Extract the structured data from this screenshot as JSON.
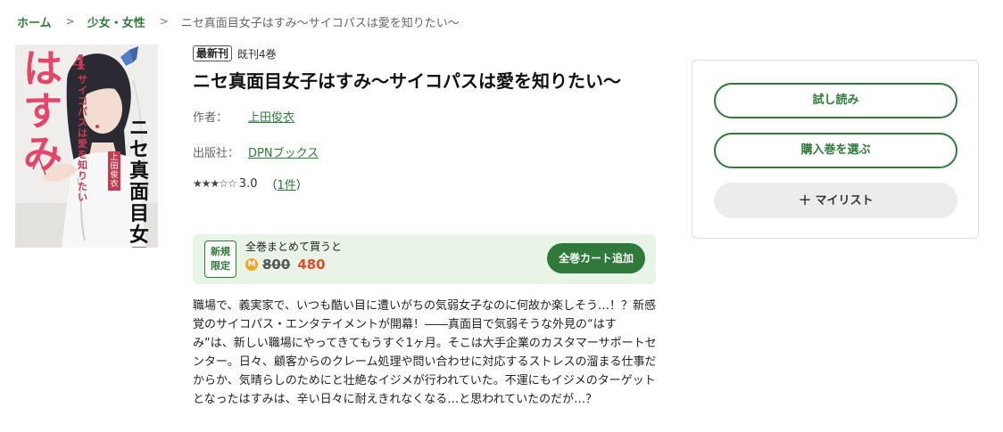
{
  "breadcrumb": {
    "items": [
      "ホーム",
      "少女・女性"
    ],
    "current": "ニセ真面目女子はすみ〜サイコパスは愛を知りたい〜"
  },
  "cover": {
    "volume_number": "4",
    "title_vertical": "はすみ",
    "subtitle_vertical": "サイコパスは愛を知りたい",
    "main_vertical": "ニセ真面目女子",
    "author_vertical": "上田俊衣"
  },
  "book": {
    "badge": "最新刊",
    "volumes": "既刊4巻",
    "title": "ニセ真面目女子はすみ〜サイコパスは愛を知りたい〜",
    "author_label": "作者：",
    "author": "上田俊衣",
    "publisher_label": "出版社：",
    "publisher": "DPNブックス",
    "stars": "★★★☆☆",
    "rating_value": "3.0",
    "rating_count_open": "（",
    "rating_count": "1件",
    "rating_count_close": "）"
  },
  "campaign": {
    "badge_line1": "新規",
    "badge_line2": "限定",
    "text": "全巻まとめて買うと",
    "coin": "M",
    "old_price": "800",
    "new_price": "480",
    "cart_label": "全巻カート追加"
  },
  "description": "職場で、義実家で、いつも酷い目に遭いがちの気弱女子なのに何故か楽しそう…！？新感覚のサイコパス・エンタテイメントが開幕！――真面目で気弱そうな外見の“はすみ”は、新しい職場にやってきてもうすぐ1ヶ月。そこは大手企業のカスタマーサポートセンター。日々、顧客からのクレーム処理や問い合わせに対応するストレスの溜まる仕事だからか、気晴らしのためにと壮絶なイジメが行われていた。不運にもイジメのターゲットとなったはすみは、辛い日々に耐えきれなくなる…と思われていたのだが…？",
  "actions": {
    "trial": "試し読み",
    "select": "購入巻を選ぶ",
    "mylist": "マイリスト"
  },
  "colors": {
    "accent": "#2f7a3a",
    "campaign_bg": "#e8f4e6",
    "price_red": "#e24b2b",
    "coin": "#f0a528"
  }
}
